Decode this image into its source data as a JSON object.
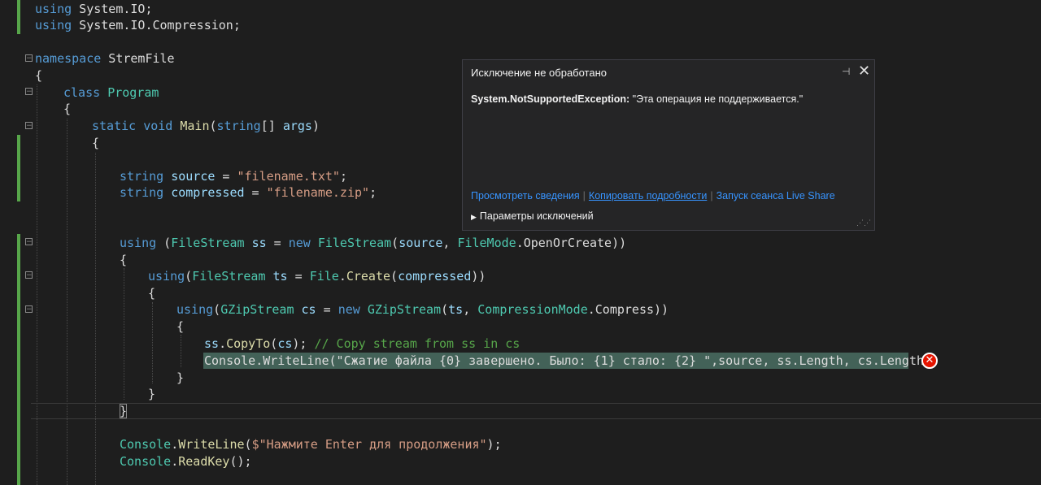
{
  "code": {
    "line1": [
      {
        "c": "kw",
        "t": "using"
      },
      {
        "c": "pl",
        "t": " System.IO;"
      }
    ],
    "line2": [
      {
        "c": "kw",
        "t": "using"
      },
      {
        "c": "pl",
        "t": " System.IO.Compression;"
      }
    ],
    "line4": [
      {
        "c": "kw",
        "t": "namespace"
      },
      {
        "c": "pl",
        "t": " StremFile"
      }
    ],
    "line5": [
      {
        "c": "pl",
        "t": "{"
      }
    ],
    "line6": [
      {
        "c": "kw",
        "t": "class"
      },
      {
        "c": "pl",
        "t": " "
      },
      {
        "c": "ty",
        "t": "Program"
      }
    ],
    "line7": [
      {
        "c": "pl",
        "t": "{"
      }
    ],
    "line8": [
      {
        "c": "kw",
        "t": "static"
      },
      {
        "c": "pl",
        "t": " "
      },
      {
        "c": "kw",
        "t": "void"
      },
      {
        "c": "pl",
        "t": " "
      },
      {
        "c": "fn",
        "t": "Main"
      },
      {
        "c": "pl",
        "t": "("
      },
      {
        "c": "kw",
        "t": "string"
      },
      {
        "c": "pl",
        "t": "[] "
      },
      {
        "c": "id",
        "t": "args"
      },
      {
        "c": "pl",
        "t": ")"
      }
    ],
    "line9": [
      {
        "c": "pl",
        "t": "{"
      }
    ],
    "line11": [
      {
        "c": "kw",
        "t": "string"
      },
      {
        "c": "pl",
        "t": " "
      },
      {
        "c": "id",
        "t": "source"
      },
      {
        "c": "pl",
        "t": " = "
      },
      {
        "c": "st",
        "t": "\"filename.txt\""
      },
      {
        "c": "pl",
        "t": ";"
      }
    ],
    "line12": [
      {
        "c": "kw",
        "t": "string"
      },
      {
        "c": "pl",
        "t": " "
      },
      {
        "c": "id",
        "t": "compressed"
      },
      {
        "c": "pl",
        "t": " = "
      },
      {
        "c": "st",
        "t": "\"filename.zip\""
      },
      {
        "c": "pl",
        "t": ";"
      }
    ],
    "line15": [
      {
        "c": "kw",
        "t": "using"
      },
      {
        "c": "pl",
        "t": " ("
      },
      {
        "c": "ty",
        "t": "FileStream"
      },
      {
        "c": "pl",
        "t": " "
      },
      {
        "c": "id",
        "t": "ss"
      },
      {
        "c": "pl",
        "t": " = "
      },
      {
        "c": "kw",
        "t": "new"
      },
      {
        "c": "pl",
        "t": " "
      },
      {
        "c": "ty",
        "t": "FileStream"
      },
      {
        "c": "pl",
        "t": "("
      },
      {
        "c": "id",
        "t": "source"
      },
      {
        "c": "pl",
        "t": ", "
      },
      {
        "c": "ty",
        "t": "FileMode"
      },
      {
        "c": "pl",
        "t": "."
      },
      {
        "c": "pl",
        "t": "OpenOrCreate))"
      }
    ],
    "line16": [
      {
        "c": "pl",
        "t": "{"
      }
    ],
    "line17": [
      {
        "c": "kw",
        "t": "using"
      },
      {
        "c": "pl",
        "t": "("
      },
      {
        "c": "ty",
        "t": "FileStream"
      },
      {
        "c": "pl",
        "t": " "
      },
      {
        "c": "id",
        "t": "ts"
      },
      {
        "c": "pl",
        "t": " = "
      },
      {
        "c": "ty",
        "t": "File"
      },
      {
        "c": "pl",
        "t": "."
      },
      {
        "c": "fn",
        "t": "Create"
      },
      {
        "c": "pl",
        "t": "("
      },
      {
        "c": "id",
        "t": "compressed"
      },
      {
        "c": "pl",
        "t": "))"
      }
    ],
    "line18": [
      {
        "c": "pl",
        "t": "{"
      }
    ],
    "line19": [
      {
        "c": "kw",
        "t": "using"
      },
      {
        "c": "pl",
        "t": "("
      },
      {
        "c": "ty",
        "t": "GZipStream"
      },
      {
        "c": "pl",
        "t": " "
      },
      {
        "c": "id",
        "t": "cs"
      },
      {
        "c": "pl",
        "t": " = "
      },
      {
        "c": "kw",
        "t": "new"
      },
      {
        "c": "pl",
        "t": " "
      },
      {
        "c": "ty",
        "t": "GZipStream"
      },
      {
        "c": "pl",
        "t": "("
      },
      {
        "c": "id",
        "t": "ts"
      },
      {
        "c": "pl",
        "t": ", "
      },
      {
        "c": "ty",
        "t": "CompressionMode"
      },
      {
        "c": "pl",
        "t": ".Compress))"
      }
    ],
    "line20": [
      {
        "c": "pl",
        "t": "{"
      }
    ],
    "line21": [
      {
        "c": "id",
        "t": "ss"
      },
      {
        "c": "pl",
        "t": "."
      },
      {
        "c": "fn",
        "t": "CopyTo"
      },
      {
        "c": "pl",
        "t": "("
      },
      {
        "c": "id",
        "t": "cs"
      },
      {
        "c": "pl",
        "t": "); "
      },
      {
        "c": "cm",
        "t": "// Copy stream from ss in cs"
      }
    ],
    "line22": [
      {
        "c": "pl",
        "t": "Console.WriteLine(\"Сжатие файла {0} завершено. Было: {1} стало: {2} \",source, ss.Length, cs.Length);"
      }
    ],
    "line23": [
      {
        "c": "pl",
        "t": "}"
      }
    ],
    "line24": [
      {
        "c": "pl",
        "t": "}"
      }
    ],
    "line25": [
      {
        "c": "pl",
        "t": "}"
      }
    ],
    "line27": [
      {
        "c": "ty",
        "t": "Console"
      },
      {
        "c": "pl",
        "t": "."
      },
      {
        "c": "fn",
        "t": "WriteLine"
      },
      {
        "c": "pl",
        "t": "("
      },
      {
        "c": "st",
        "t": "$\"Нажмите Enter для продолжения\""
      },
      {
        "c": "pl",
        "t": ");"
      }
    ],
    "line28": [
      {
        "c": "ty",
        "t": "Console"
      },
      {
        "c": "pl",
        "t": "."
      },
      {
        "c": "fn",
        "t": "ReadKey"
      },
      {
        "c": "pl",
        "t": "();"
      }
    ]
  },
  "exception_popup": {
    "title": "Исключение не обработано",
    "exception_type": "System.NotSupportedException:",
    "exception_message": " \"Эта операция не поддерживается.\"",
    "link_details": "Просмотреть сведения",
    "link_copy": "Копировать подробности",
    "link_liveshare": "Запуск сеанса Live Share",
    "params_label": "Параметры исключений",
    "pin_icon": "⊣",
    "close_icon": "✕"
  },
  "error_glyph": "✕",
  "colors": {
    "keyword": "#569cd6",
    "type": "#4ec9b0",
    "string": "#d69d85",
    "comment": "#57a64a",
    "highlight": "#4a6f63",
    "link": "#3794ff"
  }
}
